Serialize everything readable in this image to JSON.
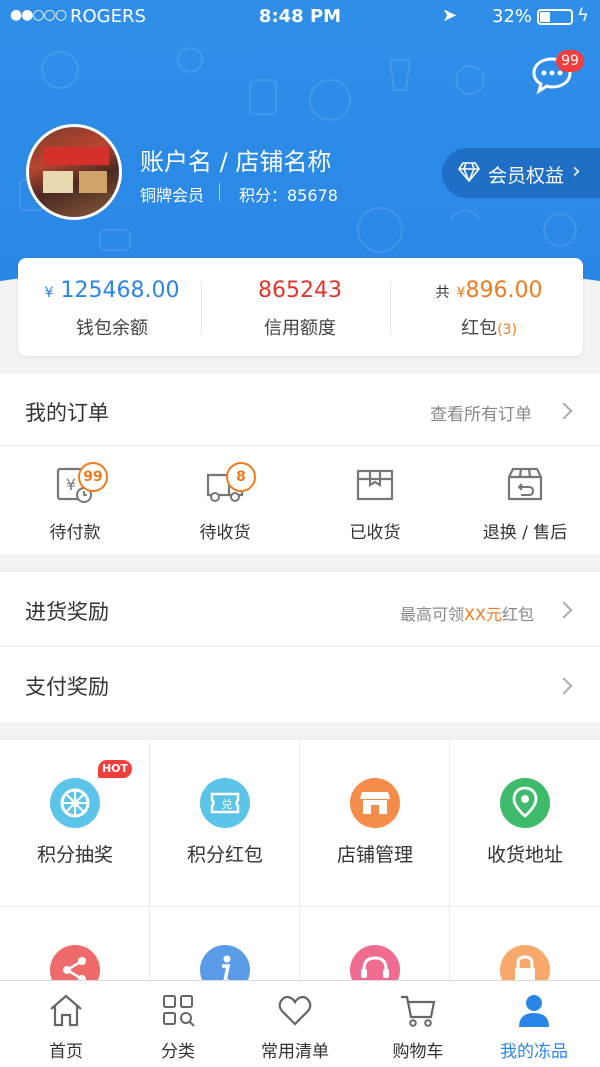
{
  "status_bar": {
    "signal": "●●○○○",
    "carrier": "ROGERS",
    "time": "8:48 PM",
    "battery": "32%"
  },
  "header": {
    "message_badge": "99",
    "account_name": "账户名 / 店铺名称",
    "member_level": "铜牌会员",
    "points": "积分：85678",
    "member_benefits": "会员权益"
  },
  "wallet": {
    "balance": {
      "currency": "¥",
      "value": "125468.00",
      "label": "钱包余额"
    },
    "credit": {
      "value": "865243",
      "label": "信用额度"
    },
    "red_packet": {
      "prefix": "共",
      "currency": "¥",
      "value": "896.00",
      "label": "红包",
      "count": "(3)"
    }
  },
  "orders": {
    "title": "我的订单",
    "view_all": "查看所有订单",
    "items": [
      {
        "label": "待付款",
        "badge": "99",
        "icon": "pending-payment-icon"
      },
      {
        "label": "待收货",
        "badge": "8",
        "icon": "delivery-truck-icon"
      },
      {
        "label": "已收货",
        "icon": "received-box-icon"
      },
      {
        "label": "退换 / 售后",
        "icon": "return-box-icon"
      }
    ]
  },
  "purchase_reward": {
    "title": "进货奖励",
    "hint_prefix": "最高可领",
    "hint_highlight": "XX元",
    "hint_suffix": "红包"
  },
  "payment_reward": {
    "title": "支付奖励"
  },
  "grid": {
    "hot_badge": "HOT",
    "items": [
      {
        "label": "积分抽奖",
        "icon": "lottery-wheel-icon",
        "color": "#5cc4e8"
      },
      {
        "label": "积分红包",
        "icon": "coupon-icon",
        "color": "#5cc4e8"
      },
      {
        "label": "店铺管理",
        "icon": "store-icon",
        "color": "#f58d4a"
      },
      {
        "label": "收货地址",
        "icon": "location-pin-icon",
        "color": "#3dbb6a"
      },
      {
        "label": "",
        "icon": "share-icon",
        "color": "#ef6b6b"
      },
      {
        "label": "",
        "icon": "info-icon",
        "color": "#5a9be8"
      },
      {
        "label": "",
        "icon": "customer-service-icon",
        "color": "#ef6b8f"
      },
      {
        "label": "",
        "icon": "lock-icon",
        "color": "#f7a86a"
      }
    ]
  },
  "tabbar": {
    "items": [
      {
        "label": "首页",
        "icon": "home-icon"
      },
      {
        "label": "分类",
        "icon": "category-icon"
      },
      {
        "label": "常用清单",
        "icon": "heart-icon"
      },
      {
        "label": "购物车",
        "icon": "cart-icon"
      },
      {
        "label": "我的冻品",
        "icon": "user-icon",
        "active": true
      }
    ]
  },
  "colors": {
    "primary": "#2a86e6",
    "price_blue": "#2a86e6",
    "price_red": "#e0362b",
    "price_orange": "#f07a1e",
    "badge_red": "#f33e3e"
  }
}
